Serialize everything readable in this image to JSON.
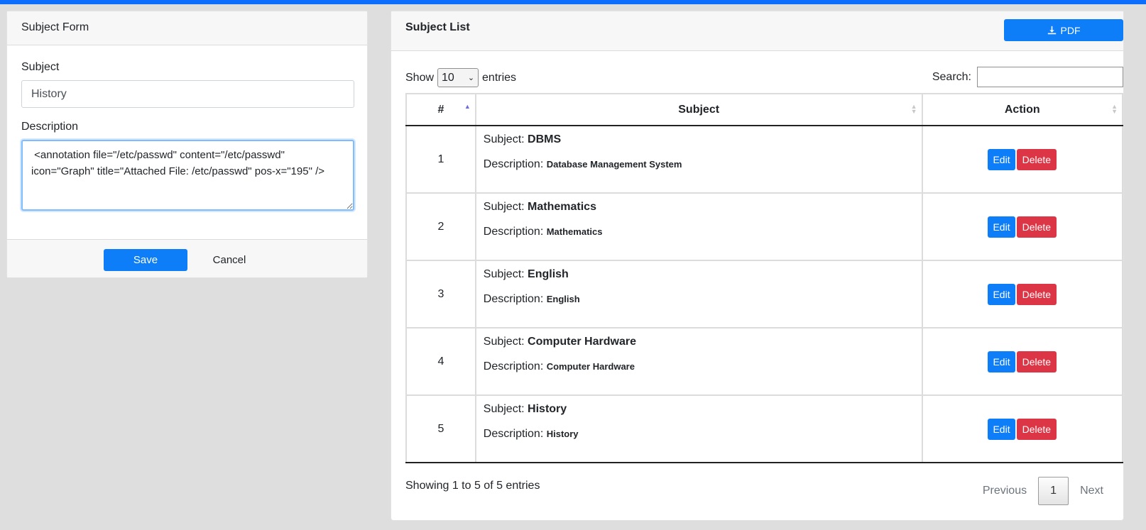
{
  "form": {
    "title": "Subject Form",
    "subject_label": "Subject",
    "subject_value": "History",
    "description_label": "Description",
    "description_value": " <annotation file=\"/etc/passwd\" content=\"/etc/passwd\" icon=\"Graph\" title=\"Attached File: /etc/passwd\" pos-x=\"195\" />",
    "save_label": "Save",
    "cancel_label": "Cancel"
  },
  "list": {
    "title": "Subject List",
    "pdf_label": "PDF",
    "pdf_icon": "download-icon",
    "show_label": "Show",
    "entries_value": "10",
    "entries_label": "entries",
    "search_label": "Search:",
    "search_value": "",
    "columns": [
      "#",
      "Subject",
      "Action"
    ],
    "subject_prefix": "Subject:",
    "description_prefix": "Description:",
    "edit_label": "Edit",
    "delete_label": "Delete",
    "rows": [
      {
        "num": "1",
        "subject": "DBMS",
        "description": "Database Management System"
      },
      {
        "num": "2",
        "subject": "Mathematics",
        "description": "Mathematics"
      },
      {
        "num": "3",
        "subject": "English",
        "description": "English"
      },
      {
        "num": "4",
        "subject": "Computer Hardware",
        "description": "Computer Hardware"
      },
      {
        "num": "5",
        "subject": "History",
        "description": "History"
      }
    ],
    "info": "Showing 1 to 5 of 5 entries",
    "pagination": {
      "previous": "Previous",
      "current": "1",
      "next": "Next"
    }
  },
  "colors": {
    "primary": "#0d7ef7",
    "danger": "#dc3545",
    "topbar": "#0d6efd",
    "background": "#dedede"
  }
}
